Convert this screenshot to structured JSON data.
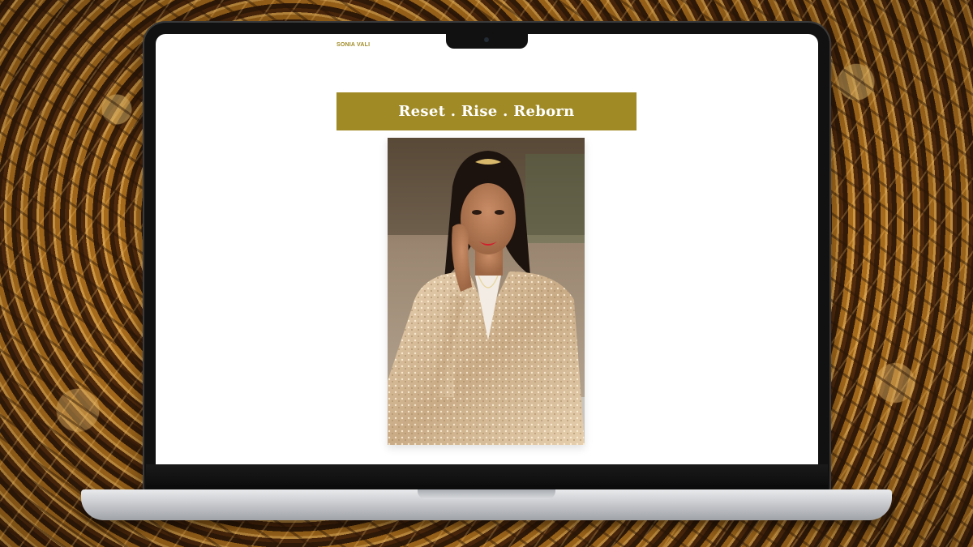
{
  "site": {
    "brand": "SONIA VALI",
    "hero_title": "Reset . Rise . Reborn",
    "portrait_alt": "Portrait of Sonia Vali in a gold sequin blazer"
  },
  "colors": {
    "accent": "#a08a25",
    "page_background": "#ffffff",
    "banner_text": "#ffffff"
  },
  "icons": {
    "camera": "camera-icon"
  }
}
